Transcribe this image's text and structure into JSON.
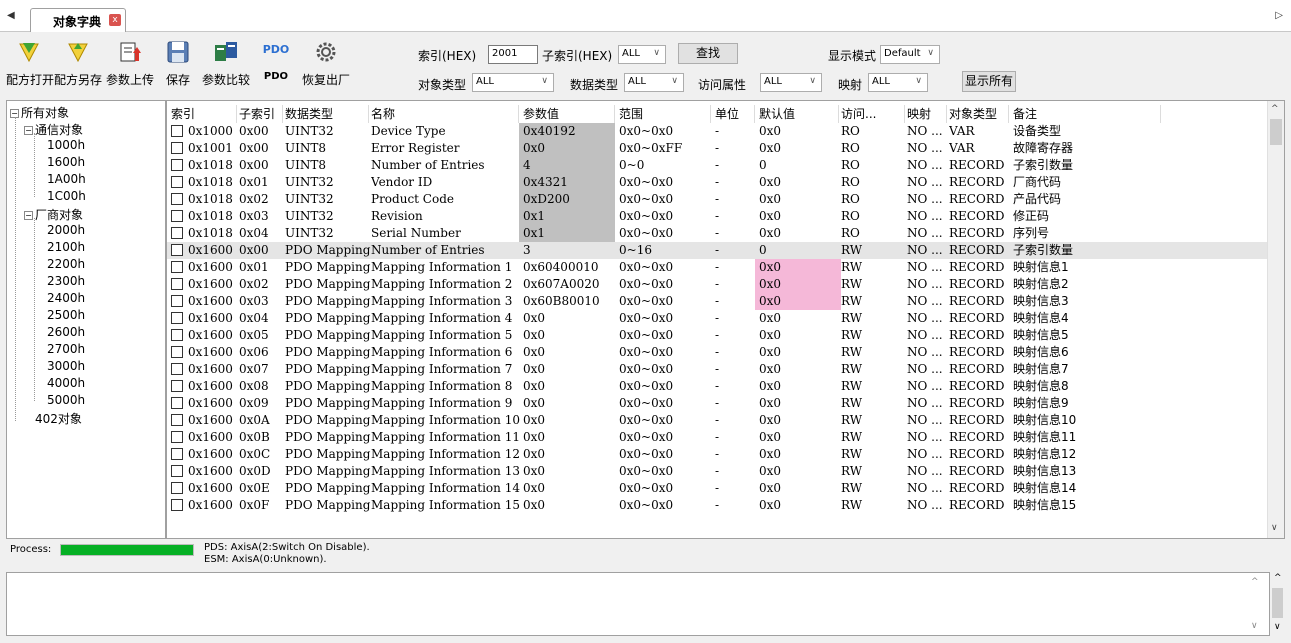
{
  "tab": {
    "label": "对象字典",
    "close": "x"
  },
  "toolbar": {
    "buttons": [
      {
        "label": "配方打开",
        "icon": "recipe-open-icon"
      },
      {
        "label": "配方另存",
        "icon": "recipe-save-as-icon"
      },
      {
        "label": "参数上传",
        "icon": "param-upload-icon"
      },
      {
        "label": "保存",
        "icon": "floppy-disk-icon"
      },
      {
        "label": "参数比较",
        "icon": "param-compare-icon"
      },
      {
        "label": "PDO",
        "icon": "pdo-icon"
      },
      {
        "label": "恢复出厂",
        "icon": "gear-icon"
      }
    ],
    "index_label": "索引(HEX)",
    "index_value": "2001",
    "subindex_label": "子索引(HEX)",
    "subindex_value": "ALL",
    "find_label": "查找",
    "display_mode_label": "显示模式",
    "display_mode_value": "Default",
    "object_type_label": "对象类型",
    "object_type_value": "ALL",
    "data_type_label": "数据类型",
    "data_type_value": "ALL",
    "access_label": "访问属性",
    "access_value": "ALL",
    "mapping_label": "映射",
    "mapping_value": "ALL",
    "show_all_label": "显示所有",
    "pdo_icon_text": "PDO"
  },
  "tree": {
    "root": "所有对象",
    "comm": "通信对象",
    "comm_children": [
      "1000h",
      "1600h",
      "1A00h",
      "1C00h"
    ],
    "vendor": "厂商对象",
    "vendor_children": [
      "2000h",
      "2100h",
      "2200h",
      "2300h",
      "2400h",
      "2500h",
      "2600h",
      "2700h",
      "3000h",
      "4000h",
      "5000h"
    ],
    "obj402": "402对象"
  },
  "grid": {
    "headers": [
      "索引",
      "子索引",
      "数据类型",
      "名称",
      "参数值",
      "范围",
      "单位",
      "默认值",
      "访问...",
      "映射",
      "对象类型",
      "备注"
    ],
    "rows": [
      [
        "0x1000",
        "0x00",
        "UINT32",
        "Device Type",
        "0x40192",
        "0x0~0x0",
        "-",
        "0x0",
        "RO",
        "NO ...",
        "VAR",
        "设备类型"
      ],
      [
        "0x1001",
        "0x00",
        "UINT8",
        "Error Register",
        "0x0",
        "0x0~0xFF",
        "-",
        "0x0",
        "RO",
        "NO ...",
        "VAR",
        "故障寄存器"
      ],
      [
        "0x1018",
        "0x00",
        "UINT8",
        "Number of Entries",
        "4",
        "0~0",
        "-",
        "0",
        "RO",
        "NO ...",
        "RECORD",
        "子索引数量"
      ],
      [
        "0x1018",
        "0x01",
        "UINT32",
        "Vendor ID",
        "0x4321",
        "0x0~0x0",
        "-",
        "0x0",
        "RO",
        "NO ...",
        "RECORD",
        "厂商代码"
      ],
      [
        "0x1018",
        "0x02",
        "UINT32",
        "Product Code",
        "0xD200",
        "0x0~0x0",
        "-",
        "0x0",
        "RO",
        "NO ...",
        "RECORD",
        "产品代码"
      ],
      [
        "0x1018",
        "0x03",
        "UINT32",
        "Revision",
        "0x1",
        "0x0~0x0",
        "-",
        "0x0",
        "RO",
        "NO ...",
        "RECORD",
        "修正码"
      ],
      [
        "0x1018",
        "0x04",
        "UINT32",
        "Serial Number",
        "0x1",
        "0x0~0x0",
        "-",
        "0x0",
        "RO",
        "NO ...",
        "RECORD",
        "序列号"
      ],
      [
        "0x1600",
        "0x00",
        "PDO Mapping",
        "Number of Entries",
        "3",
        "0~16",
        "-",
        "0",
        "RW",
        "NO ...",
        "RECORD",
        "子索引数量"
      ],
      [
        "0x1600",
        "0x01",
        "PDO Mapping",
        "Mapping Information 1",
        "0x60400010",
        "0x0~0x0",
        "-",
        "0x0",
        "RW",
        "NO ...",
        "RECORD",
        "映射信息1"
      ],
      [
        "0x1600",
        "0x02",
        "PDO Mapping",
        "Mapping Information 2",
        "0x607A0020",
        "0x0~0x0",
        "-",
        "0x0",
        "RW",
        "NO ...",
        "RECORD",
        "映射信息2"
      ],
      [
        "0x1600",
        "0x03",
        "PDO Mapping",
        "Mapping Information 3",
        "0x60B80010",
        "0x0~0x0",
        "-",
        "0x0",
        "RW",
        "NO ...",
        "RECORD",
        "映射信息3"
      ],
      [
        "0x1600",
        "0x04",
        "PDO Mapping",
        "Mapping Information 4",
        "0x0",
        "0x0~0x0",
        "-",
        "0x0",
        "RW",
        "NO ...",
        "RECORD",
        "映射信息4"
      ],
      [
        "0x1600",
        "0x05",
        "PDO Mapping",
        "Mapping Information 5",
        "0x0",
        "0x0~0x0",
        "-",
        "0x0",
        "RW",
        "NO ...",
        "RECORD",
        "映射信息5"
      ],
      [
        "0x1600",
        "0x06",
        "PDO Mapping",
        "Mapping Information 6",
        "0x0",
        "0x0~0x0",
        "-",
        "0x0",
        "RW",
        "NO ...",
        "RECORD",
        "映射信息6"
      ],
      [
        "0x1600",
        "0x07",
        "PDO Mapping",
        "Mapping Information 7",
        "0x0",
        "0x0~0x0",
        "-",
        "0x0",
        "RW",
        "NO ...",
        "RECORD",
        "映射信息7"
      ],
      [
        "0x1600",
        "0x08",
        "PDO Mapping",
        "Mapping Information 8",
        "0x0",
        "0x0~0x0",
        "-",
        "0x0",
        "RW",
        "NO ...",
        "RECORD",
        "映射信息8"
      ],
      [
        "0x1600",
        "0x09",
        "PDO Mapping",
        "Mapping Information 9",
        "0x0",
        "0x0~0x0",
        "-",
        "0x0",
        "RW",
        "NO ...",
        "RECORD",
        "映射信息9"
      ],
      [
        "0x1600",
        "0x0A",
        "PDO Mapping",
        "Mapping Information 10",
        "0x0",
        "0x0~0x0",
        "-",
        "0x0",
        "RW",
        "NO ...",
        "RECORD",
        "映射信息10"
      ],
      [
        "0x1600",
        "0x0B",
        "PDO Mapping",
        "Mapping Information 11",
        "0x0",
        "0x0~0x0",
        "-",
        "0x0",
        "RW",
        "NO ...",
        "RECORD",
        "映射信息11"
      ],
      [
        "0x1600",
        "0x0C",
        "PDO Mapping",
        "Mapping Information 12",
        "0x0",
        "0x0~0x0",
        "-",
        "0x0",
        "RW",
        "NO ...",
        "RECORD",
        "映射信息12"
      ],
      [
        "0x1600",
        "0x0D",
        "PDO Mapping",
        "Mapping Information 13",
        "0x0",
        "0x0~0x0",
        "-",
        "0x0",
        "RW",
        "NO ...",
        "RECORD",
        "映射信息13"
      ],
      [
        "0x1600",
        "0x0E",
        "PDO Mapping",
        "Mapping Information 14",
        "0x0",
        "0x0~0x0",
        "-",
        "0x0",
        "RW",
        "NO ...",
        "RECORD",
        "映射信息14"
      ],
      [
        "0x1600",
        "0x0F",
        "PDO Mapping",
        "Mapping Information 15",
        "0x0",
        "0x0~0x0",
        "-",
        "0x0",
        "RW",
        "NO ...",
        "RECORD",
        "映射信息15"
      ]
    ],
    "readonly_value_bg": "#c0c0c0",
    "modified_default_bg": "#f5b8d8",
    "highlight_row_bg": "#e5e5e5"
  },
  "status": {
    "process_label": "Process:",
    "progress": 1.0,
    "progress_color": "#06b025",
    "pds_text": "PDS: AxisA(2:Switch On Disable).",
    "esm_text": "ESM: AxisA(0:Unknown)."
  }
}
